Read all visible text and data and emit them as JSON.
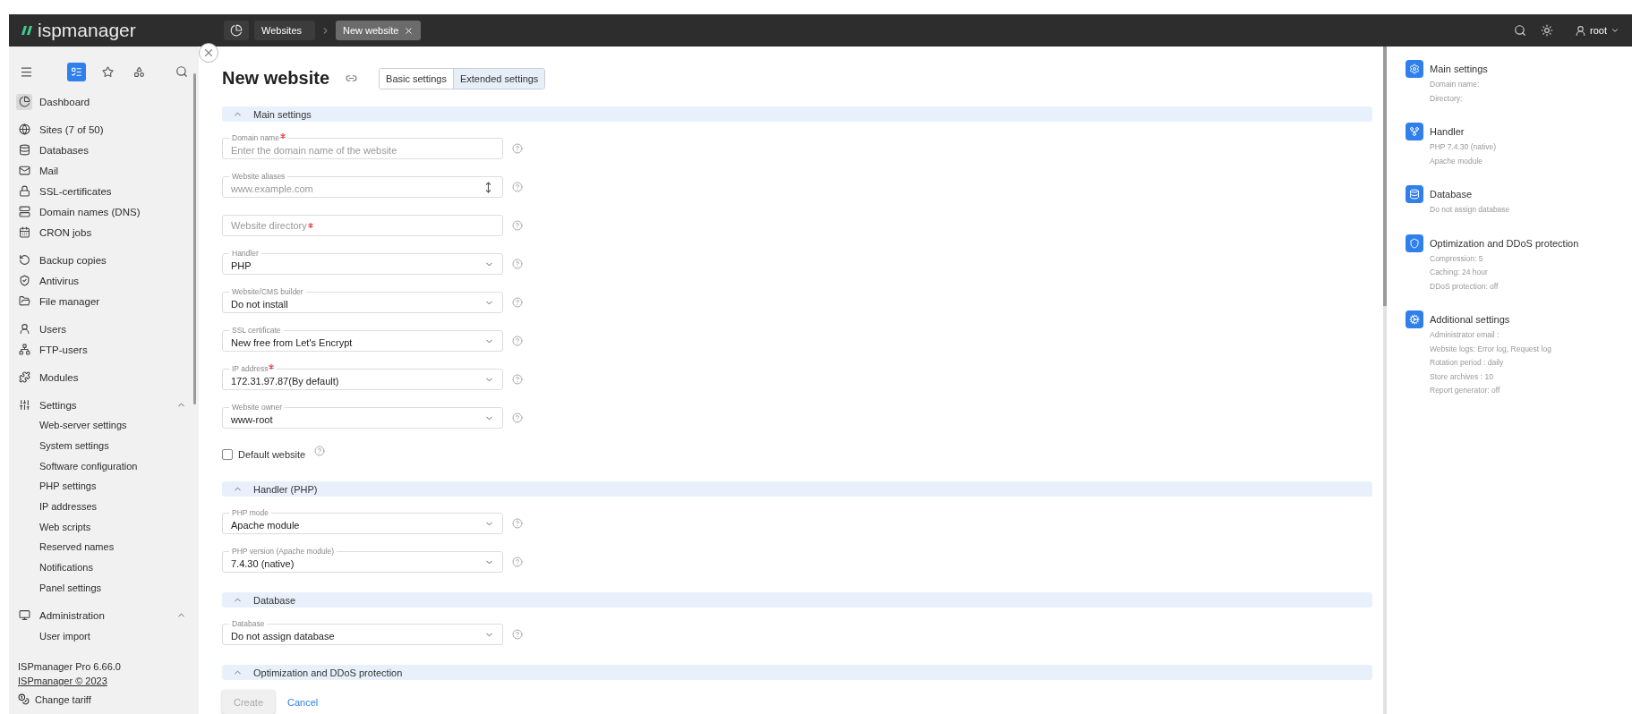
{
  "header": {
    "logo": "ispmanager",
    "breadcrumbs": [
      {
        "label": "Websites",
        "selected": false
      },
      {
        "label": "New website",
        "selected": true
      }
    ],
    "user": "root"
  },
  "sidebar": {
    "tools": [
      {
        "selected": true
      },
      {
        "selected": false
      },
      {
        "selected": false
      }
    ],
    "groups": [
      {
        "items": [
          {
            "label": "Dashboard",
            "selected": true
          }
        ]
      },
      {
        "items": [
          {
            "label": "Sites (7 of 50)",
            "selected": false
          },
          {
            "label": "Databases",
            "selected": false
          },
          {
            "label": "Mail",
            "selected": false
          },
          {
            "label": "SSL-certificates",
            "selected": false
          },
          {
            "label": "Domain names (DNS)",
            "selected": false
          },
          {
            "label": "CRON jobs",
            "selected": false
          }
        ]
      },
      {
        "items": [
          {
            "label": "Backup copies",
            "selected": false
          },
          {
            "label": "Antivirus",
            "selected": false
          },
          {
            "label": "File manager",
            "selected": false
          }
        ]
      },
      {
        "items": [
          {
            "label": "Users",
            "selected": false
          },
          {
            "label": "FTP-users",
            "selected": false
          }
        ]
      },
      {
        "items": [
          {
            "label": "Modules",
            "selected": false
          }
        ]
      },
      {
        "items": [
          {
            "label": "Settings",
            "selected": false,
            "expanded": true,
            "children": [
              "Web-server settings",
              "System settings",
              "Software configuration",
              "PHP settings",
              "IP addresses",
              "Web scripts",
              "Reserved names",
              "Notifications",
              "Panel settings"
            ]
          }
        ]
      },
      {
        "items": [
          {
            "label": "Administration",
            "selected": false,
            "expanded": true,
            "children": [
              "User import"
            ]
          }
        ]
      }
    ],
    "version": "ISPmanager Pro 6.66.0",
    "copyright": "ISPmanager © 2023",
    "change_tariff": "Change tariff"
  },
  "form": {
    "title": "New website",
    "tabs": [
      {
        "label": "Basic settings",
        "selected": false
      },
      {
        "label": "Extended settings",
        "selected": true
      }
    ],
    "sections": [
      {
        "title": "Main settings",
        "expanded": true,
        "fields": [
          {
            "kind": "text",
            "label": "Domain name",
            "required": true,
            "placeholder": "Enter the domain name of the website"
          },
          {
            "kind": "textarea",
            "label": "Website aliases",
            "required": false,
            "placeholder": "www.example.com"
          },
          {
            "kind": "text",
            "required": true,
            "placeholder": "Website directory"
          },
          {
            "kind": "select",
            "label": "Handler",
            "required": false,
            "value": "PHP"
          },
          {
            "kind": "select",
            "label": "Website/CMS builder",
            "required": false,
            "value": "Do not install"
          },
          {
            "kind": "select",
            "label": "SSL certificate",
            "required": false,
            "value": "New free from Let's Encrypt"
          },
          {
            "kind": "select",
            "label": "IP address",
            "required": true,
            "value": "172.31.97.87(By default)"
          },
          {
            "kind": "select",
            "label": "Website owner",
            "required": false,
            "value": "www-root"
          },
          {
            "kind": "checkbox",
            "label": "Default website",
            "checked": false
          }
        ]
      },
      {
        "title": "Handler (PHP)",
        "expanded": true,
        "fields": [
          {
            "kind": "select",
            "label": "PHP mode",
            "required": false,
            "value": "Apache module"
          },
          {
            "kind": "select",
            "label": "PHP version (Apache module)",
            "required": false,
            "value": "7.4.30 (native)"
          }
        ]
      },
      {
        "title": "Database",
        "expanded": true,
        "fields": [
          {
            "kind": "select",
            "label": "Database",
            "required": false,
            "value": "Do not assign database"
          }
        ]
      },
      {
        "title": "Optimization and DDoS protection",
        "expanded": true
      }
    ],
    "buttons": {
      "create": {
        "label": "Create",
        "disabled": true
      },
      "cancel": "Cancel"
    }
  },
  "summary": [
    {
      "title": "Main settings",
      "lines": [
        "Domain name:",
        "Directory:"
      ]
    },
    {
      "title": "Handler",
      "lines": [
        "PHP 7.4.30 (native)",
        "Apache module"
      ]
    },
    {
      "title": "Database",
      "lines": [
        "Do not assign database"
      ]
    },
    {
      "title": "Optimization and DDoS protection",
      "lines": [
        "Compression: 5",
        "Caching: 24 hour",
        "DDoS protection: off"
      ]
    },
    {
      "title": "Additional settings",
      "lines": [
        "Administrator email :",
        "Website logs: Error log, Request log",
        "Rotation period : daily",
        "Store archives : 10",
        "Report generator: off"
      ]
    }
  ]
}
